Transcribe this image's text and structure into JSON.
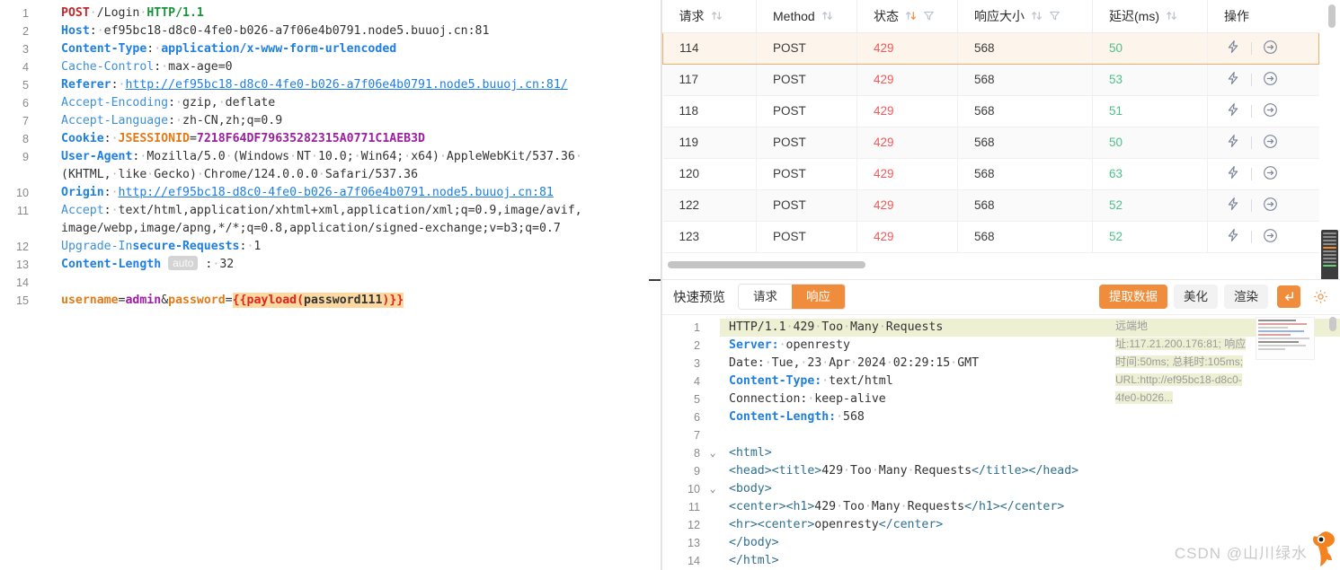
{
  "request_editor": {
    "lines": [
      {
        "n": "1",
        "tokens": [
          {
            "t": "method",
            "v": "POST"
          },
          {
            "t": "dot",
            "v": "·"
          },
          {
            "t": "path",
            "v": "/Login"
          },
          {
            "t": "dot",
            "v": "·"
          },
          {
            "t": "proto",
            "v": "HTTP/1.1"
          }
        ]
      },
      {
        "n": "2",
        "tokens": [
          {
            "t": "hdr",
            "v": "Host"
          },
          {
            "t": "plain",
            "v": ":"
          },
          {
            "t": "dot",
            "v": "·"
          },
          {
            "t": "val",
            "v": "ef95bc18-d8c0-4fe0-b026-a7f06e4b0791.node5.buuoj.cn:81"
          }
        ]
      },
      {
        "n": "3",
        "tokens": [
          {
            "t": "hdr",
            "v": "Content-Type"
          },
          {
            "t": "plain",
            "v": ":"
          },
          {
            "t": "dot",
            "v": "·"
          },
          {
            "t": "valb",
            "v": "application/x-www-form-urlencoded"
          }
        ]
      },
      {
        "n": "4",
        "tokens": [
          {
            "t": "hdrn",
            "v": "Cache-Control"
          },
          {
            "t": "plain",
            "v": ":"
          },
          {
            "t": "dot",
            "v": "·"
          },
          {
            "t": "val",
            "v": "max-age=0"
          }
        ]
      },
      {
        "n": "5",
        "tokens": [
          {
            "t": "hdr",
            "v": "Referer"
          },
          {
            "t": "plain",
            "v": ":"
          },
          {
            "t": "dot",
            "v": "·"
          },
          {
            "t": "link",
            "v": "http://ef95bc18-d8c0-4fe0-b026-a7f06e4b0791.node5.buuoj.cn:81/"
          }
        ]
      },
      {
        "n": "6",
        "tokens": [
          {
            "t": "hdrn",
            "v": "Accept-Encoding"
          },
          {
            "t": "plain",
            "v": ":"
          },
          {
            "t": "dot",
            "v": "·"
          },
          {
            "t": "val",
            "v": "gzip,"
          },
          {
            "t": "dot",
            "v": "·"
          },
          {
            "t": "val",
            "v": "deflate"
          }
        ]
      },
      {
        "n": "7",
        "tokens": [
          {
            "t": "hdrn",
            "v": "Accept-Language"
          },
          {
            "t": "plain",
            "v": ":"
          },
          {
            "t": "dot",
            "v": "·"
          },
          {
            "t": "val",
            "v": "zh-CN,zh;q=0.9"
          }
        ]
      },
      {
        "n": "8",
        "tokens": [
          {
            "t": "hdr",
            "v": "Cookie"
          },
          {
            "t": "plain",
            "v": ":"
          },
          {
            "t": "dot",
            "v": "·"
          },
          {
            "t": "key",
            "v": "JSESSIONID"
          },
          {
            "t": "plain",
            "v": "="
          },
          {
            "t": "purple",
            "v": "7218F64DF79635282315A0771C1AEB3D"
          }
        ]
      },
      {
        "n": "9",
        "tokens": [
          {
            "t": "hdr",
            "v": "User-Agent"
          },
          {
            "t": "plain",
            "v": ":"
          },
          {
            "t": "dot",
            "v": "·"
          },
          {
            "t": "val",
            "v": "Mozilla/5.0"
          },
          {
            "t": "dot",
            "v": "·"
          },
          {
            "t": "val",
            "v": "(Windows"
          },
          {
            "t": "dot",
            "v": "·"
          },
          {
            "t": "val",
            "v": "NT"
          },
          {
            "t": "dot",
            "v": "·"
          },
          {
            "t": "val",
            "v": "10.0;"
          },
          {
            "t": "dot",
            "v": "·"
          },
          {
            "t": "val",
            "v": "Win64;"
          },
          {
            "t": "dot",
            "v": "·"
          },
          {
            "t": "val",
            "v": "x64)"
          },
          {
            "t": "dot",
            "v": "·"
          },
          {
            "t": "val",
            "v": "AppleWebKit/537.36"
          },
          {
            "t": "dot",
            "v": "·"
          }
        ]
      },
      {
        "n": "",
        "tokens": [
          {
            "t": "val",
            "v": "(KHTML,"
          },
          {
            "t": "dot",
            "v": "·"
          },
          {
            "t": "val",
            "v": "like"
          },
          {
            "t": "dot",
            "v": "·"
          },
          {
            "t": "val",
            "v": "Gecko)"
          },
          {
            "t": "dot",
            "v": "·"
          },
          {
            "t": "val",
            "v": "Chrome/124.0.0.0"
          },
          {
            "t": "dot",
            "v": "·"
          },
          {
            "t": "val",
            "v": "Safari/537.36"
          }
        ]
      },
      {
        "n": "10",
        "tokens": [
          {
            "t": "hdr",
            "v": "Origin"
          },
          {
            "t": "plain",
            "v": ":"
          },
          {
            "t": "dot",
            "v": "·"
          },
          {
            "t": "link",
            "v": "http://ef95bc18-d8c0-4fe0-b026-a7f06e4b0791.node5.buuoj.cn:81"
          }
        ]
      },
      {
        "n": "11",
        "tokens": [
          {
            "t": "hdrn",
            "v": "Accept"
          },
          {
            "t": "plain",
            "v": ":"
          },
          {
            "t": "dot",
            "v": "·"
          },
          {
            "t": "val",
            "v": "text/html,application/xhtml+xml,application/xml;q=0.9,image/avif,"
          }
        ]
      },
      {
        "n": "",
        "tokens": [
          {
            "t": "val",
            "v": "image/webp,image/apng,*/*;q=0.8,application/signed-exchange;v=b3;q=0.7"
          }
        ]
      },
      {
        "n": "12",
        "tokens": [
          {
            "t": "hdrn",
            "v": "Upgrade-In"
          },
          {
            "t": "hdr",
            "v": "secure-Requests"
          },
          {
            "t": "plain",
            "v": ":"
          },
          {
            "t": "dot",
            "v": "·"
          },
          {
            "t": "val",
            "v": "1"
          }
        ]
      },
      {
        "n": "13",
        "tokens": [
          {
            "t": "hdr",
            "v": "Content-Length"
          },
          {
            "t": "badge",
            "v": "auto"
          },
          {
            "t": "plain",
            "v": ":"
          },
          {
            "t": "dot",
            "v": "·"
          },
          {
            "t": "val",
            "v": "32"
          }
        ]
      },
      {
        "n": "14",
        "tokens": []
      },
      {
        "n": "15",
        "tokens": [
          {
            "t": "key",
            "v": "username"
          },
          {
            "t": "plain",
            "v": "="
          },
          {
            "t": "purple",
            "v": "admin"
          },
          {
            "t": "plain",
            "v": "&"
          },
          {
            "t": "key",
            "v": "password"
          },
          {
            "t": "plain",
            "v": "="
          },
          {
            "t": "payload",
            "v": "{{payload(password111)}}"
          }
        ]
      }
    ]
  },
  "table": {
    "columns": [
      {
        "label": "请求",
        "sortable": true,
        "sort_state": "none",
        "filter": false
      },
      {
        "label": "Method",
        "sortable": true,
        "sort_state": "none",
        "filter": false
      },
      {
        "label": "状态",
        "sortable": true,
        "sort_state": "desc",
        "filter": true
      },
      {
        "label": "响应大小",
        "sortable": true,
        "sort_state": "none",
        "filter": true
      },
      {
        "label": "延迟(ms)",
        "sortable": true,
        "sort_state": "none",
        "filter": false
      },
      {
        "label": "操作",
        "sortable": false,
        "sort_state": "none",
        "filter": false
      }
    ],
    "rows": [
      {
        "id": "114",
        "method": "POST",
        "status": "429",
        "size": "568",
        "latency": "50",
        "selected": true
      },
      {
        "id": "117",
        "method": "POST",
        "status": "429",
        "size": "568",
        "latency": "53",
        "selected": false
      },
      {
        "id": "118",
        "method": "POST",
        "status": "429",
        "size": "568",
        "latency": "51",
        "selected": false
      },
      {
        "id": "119",
        "method": "POST",
        "status": "429",
        "size": "568",
        "latency": "50",
        "selected": false
      },
      {
        "id": "120",
        "method": "POST",
        "status": "429",
        "size": "568",
        "latency": "63",
        "selected": false
      },
      {
        "id": "122",
        "method": "POST",
        "status": "429",
        "size": "568",
        "latency": "52",
        "selected": false
      },
      {
        "id": "123",
        "method": "POST",
        "status": "429",
        "size": "568",
        "latency": "52",
        "selected": false
      }
    ],
    "row_action_icons": [
      "lightning-icon",
      "send-arrow-icon"
    ]
  },
  "preview_toolbar": {
    "title": "快速预览",
    "tabs": [
      {
        "label": "请求",
        "active": false
      },
      {
        "label": "响应",
        "active": true
      }
    ],
    "actions": [
      {
        "label": "提取数据",
        "style": "primary"
      },
      {
        "label": "美化",
        "style": "default"
      },
      {
        "label": "渲染",
        "style": "default"
      }
    ],
    "wrap_icon": "word-wrap-icon",
    "settings_icon": "gear-icon"
  },
  "response_viewer": {
    "info": "远端地址:117.21.200.176:81; 响应时间:50ms; 总耗时:105ms; URL:http://ef95bc18-d8c0-4fe0-b026...",
    "lines": [
      {
        "n": "1",
        "fold": "",
        "highlight": true,
        "tokens": [
          {
            "t": "plain",
            "v": "HTTP/1.1"
          },
          {
            "t": "dot",
            "v": "·"
          },
          {
            "t": "plain",
            "v": "429"
          },
          {
            "t": "dot",
            "v": "·"
          },
          {
            "t": "plain",
            "v": "Too"
          },
          {
            "t": "dot",
            "v": "·"
          },
          {
            "t": "plain",
            "v": "Many"
          },
          {
            "t": "dot",
            "v": "·"
          },
          {
            "t": "plain",
            "v": "Requests"
          }
        ]
      },
      {
        "n": "2",
        "fold": "",
        "highlight": false,
        "tokens": [
          {
            "t": "rhdr",
            "v": "Server:"
          },
          {
            "t": "dot",
            "v": "·"
          },
          {
            "t": "plain",
            "v": "openresty"
          }
        ]
      },
      {
        "n": "3",
        "fold": "",
        "highlight": false,
        "tokens": [
          {
            "t": "plain",
            "v": "Date:"
          },
          {
            "t": "dot",
            "v": "·"
          },
          {
            "t": "plain",
            "v": "Tue,"
          },
          {
            "t": "dot",
            "v": "·"
          },
          {
            "t": "plain",
            "v": "23"
          },
          {
            "t": "dot",
            "v": "·"
          },
          {
            "t": "plain",
            "v": "Apr"
          },
          {
            "t": "dot",
            "v": "·"
          },
          {
            "t": "plain",
            "v": "2024"
          },
          {
            "t": "dot",
            "v": "·"
          },
          {
            "t": "plain",
            "v": "02:29:15"
          },
          {
            "t": "dot",
            "v": "·"
          },
          {
            "t": "plain",
            "v": "GMT"
          }
        ]
      },
      {
        "n": "4",
        "fold": "",
        "highlight": false,
        "tokens": [
          {
            "t": "rhdr",
            "v": "Content-Type:"
          },
          {
            "t": "dot",
            "v": "·"
          },
          {
            "t": "plain",
            "v": "text/html"
          }
        ]
      },
      {
        "n": "5",
        "fold": "",
        "highlight": false,
        "tokens": [
          {
            "t": "plain",
            "v": "Connection:"
          },
          {
            "t": "dot",
            "v": "·"
          },
          {
            "t": "plain",
            "v": "keep-alive"
          }
        ]
      },
      {
        "n": "6",
        "fold": "",
        "highlight": false,
        "tokens": [
          {
            "t": "rhdr",
            "v": "Content-Length:"
          },
          {
            "t": "dot",
            "v": "·"
          },
          {
            "t": "plain",
            "v": "568"
          }
        ]
      },
      {
        "n": "7",
        "fold": "",
        "highlight": false,
        "tokens": []
      },
      {
        "n": "8",
        "fold": "v",
        "highlight": false,
        "tokens": [
          {
            "t": "tag",
            "v": "<html>"
          }
        ]
      },
      {
        "n": "9",
        "fold": "",
        "highlight": false,
        "tokens": [
          {
            "t": "tag",
            "v": "<head><title>"
          },
          {
            "t": "plain",
            "v": "429"
          },
          {
            "t": "dot",
            "v": "·"
          },
          {
            "t": "plain",
            "v": "Too"
          },
          {
            "t": "dot",
            "v": "·"
          },
          {
            "t": "plain",
            "v": "Many"
          },
          {
            "t": "dot",
            "v": "·"
          },
          {
            "t": "plain",
            "v": "Requests"
          },
          {
            "t": "tag",
            "v": "</title></head>"
          }
        ]
      },
      {
        "n": "10",
        "fold": "v",
        "highlight": false,
        "tokens": [
          {
            "t": "tag",
            "v": "<body>"
          }
        ]
      },
      {
        "n": "11",
        "fold": "",
        "highlight": false,
        "tokens": [
          {
            "t": "tag",
            "v": "<center><h1>"
          },
          {
            "t": "plain",
            "v": "429"
          },
          {
            "t": "dot",
            "v": "·"
          },
          {
            "t": "plain",
            "v": "Too"
          },
          {
            "t": "dot",
            "v": "·"
          },
          {
            "t": "plain",
            "v": "Many"
          },
          {
            "t": "dot",
            "v": "·"
          },
          {
            "t": "plain",
            "v": "Requests"
          },
          {
            "t": "tag",
            "v": "</h1></center>"
          }
        ]
      },
      {
        "n": "12",
        "fold": "",
        "highlight": false,
        "tokens": [
          {
            "t": "tag",
            "v": "<hr><center>"
          },
          {
            "t": "plain",
            "v": "openresty"
          },
          {
            "t": "tag",
            "v": "</center>"
          }
        ]
      },
      {
        "n": "13",
        "fold": "",
        "highlight": false,
        "tokens": [
          {
            "t": "tag",
            "v": "</body>"
          }
        ]
      },
      {
        "n": "14",
        "fold": "",
        "highlight": false,
        "tokens": [
          {
            "t": "tag",
            "v": "</html>"
          }
        ]
      }
    ]
  },
  "watermark": {
    "text": "CSDN @山川绿水"
  },
  "colors": {
    "accent": "#f08d3c",
    "error": "#f05a5a",
    "success": "#4ec08a",
    "link": "#1f7fe0",
    "method": "#c3272b",
    "proto": "#1a8f3c",
    "key": "#e07b1a",
    "value": "#9b1fa0",
    "payload_bg": "#fcd9a0"
  }
}
